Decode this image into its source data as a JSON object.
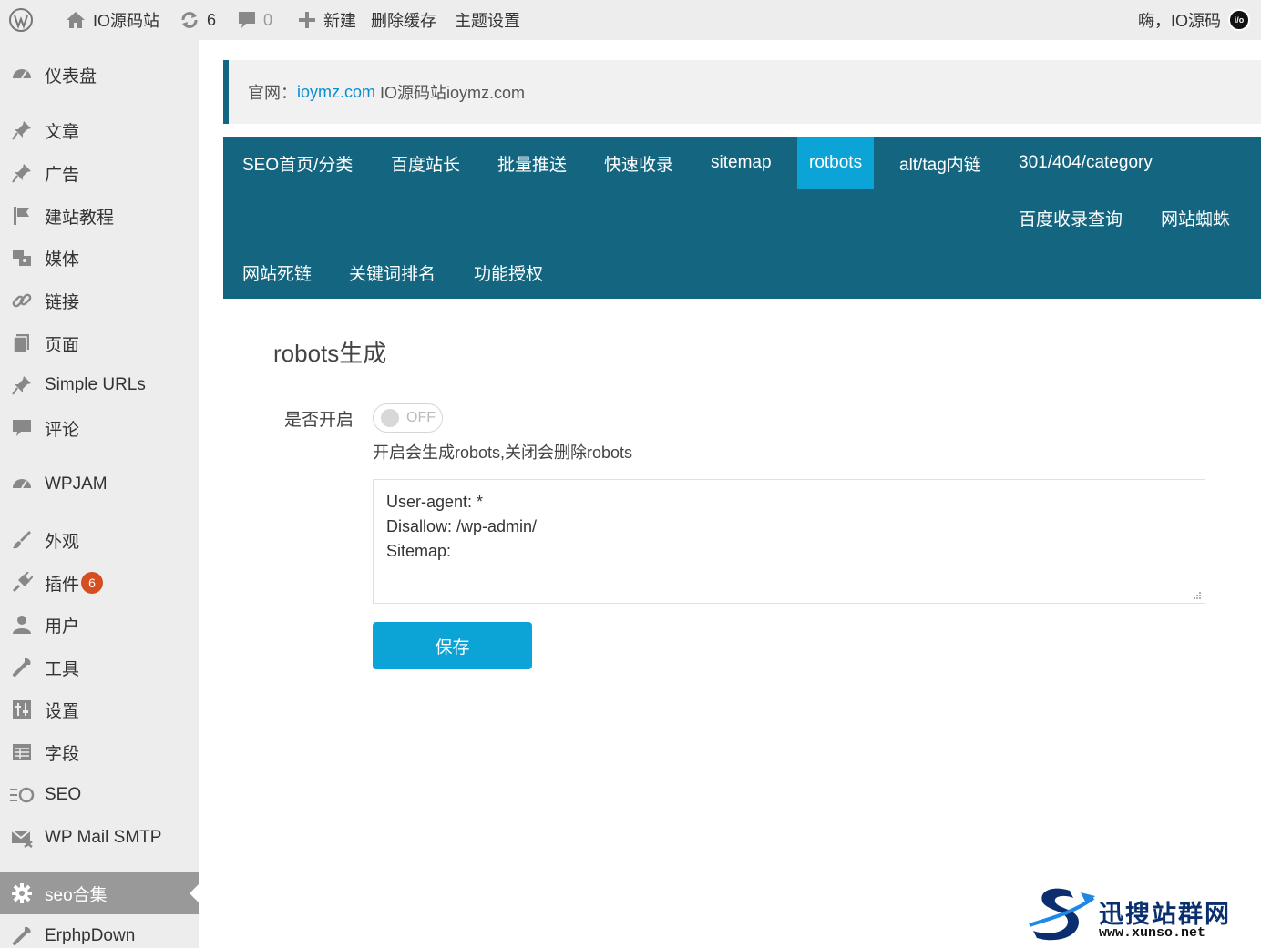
{
  "adminbar": {
    "site_name": "IO源码站",
    "updates_count": "6",
    "comments_count": "0",
    "new_label": "新建",
    "clear_cache_label": "删除缓存",
    "theme_settings_label": "主题设置",
    "greeting": "嗨，IO源码",
    "avatar_text": "i/o"
  },
  "sidebar": {
    "items": [
      {
        "label": "仪表盘",
        "icon": "dashboard-icon"
      },
      {
        "label": "文章",
        "icon": "pin-icon"
      },
      {
        "label": "广告",
        "icon": "pin-icon"
      },
      {
        "label": "建站教程",
        "icon": "flag-icon"
      },
      {
        "label": "媒体",
        "icon": "media-icon"
      },
      {
        "label": "链接",
        "icon": "link-icon"
      },
      {
        "label": "页面",
        "icon": "page-icon"
      },
      {
        "label": "Simple URLs",
        "icon": "pin-icon"
      },
      {
        "label": "评论",
        "icon": "comment-icon"
      },
      {
        "label": "WPJAM",
        "icon": "dashboard-icon"
      },
      {
        "label": "外观",
        "icon": "brush-icon"
      },
      {
        "label": "插件",
        "icon": "plugin-icon",
        "badge": "6"
      },
      {
        "label": "用户",
        "icon": "user-icon"
      },
      {
        "label": "工具",
        "icon": "wrench-icon"
      },
      {
        "label": "设置",
        "icon": "settings-icon"
      },
      {
        "label": "字段",
        "icon": "table-icon"
      },
      {
        "label": "SEO",
        "icon": "seo-icon"
      },
      {
        "label": "WP Mail SMTP",
        "icon": "mail-icon"
      },
      {
        "label": "seo合集",
        "icon": "gear-icon",
        "active": true
      },
      {
        "label": "ErphpDown",
        "icon": "wrench-icon"
      }
    ]
  },
  "notice": {
    "prefix": "官网：",
    "link_text": "ioymz.com",
    "suffix": " IO源码站ioymz.com"
  },
  "tabs": [
    "SEO首页/分类",
    "百度站长",
    "批量推送",
    "快速收录",
    "sitemap",
    "rotbots",
    "alt/tag内链",
    "301/404/category",
    "百度收录查询",
    "网站蜘蛛",
    "网站死链",
    "关键词排名",
    "功能授权"
  ],
  "active_tab": "rotbots",
  "section": {
    "title": "robots生成",
    "field_label": "是否开启",
    "toggle_state": "OFF",
    "help_text": "开启会生成robots,关闭会删除robots",
    "robots_lines": [
      "User-agent: *",
      "Disallow: /wp-admin/",
      "Sitemap:"
    ],
    "save_label": "保存"
  },
  "colors": {
    "tab_bg": "#136580",
    "tab_active": "#0ca4d6",
    "button": "#0ca4d6",
    "link": "#0b8ed0",
    "badge": "#d54e21"
  },
  "watermark": {
    "title": "迅搜站群网",
    "url": "www.xunso.net"
  }
}
